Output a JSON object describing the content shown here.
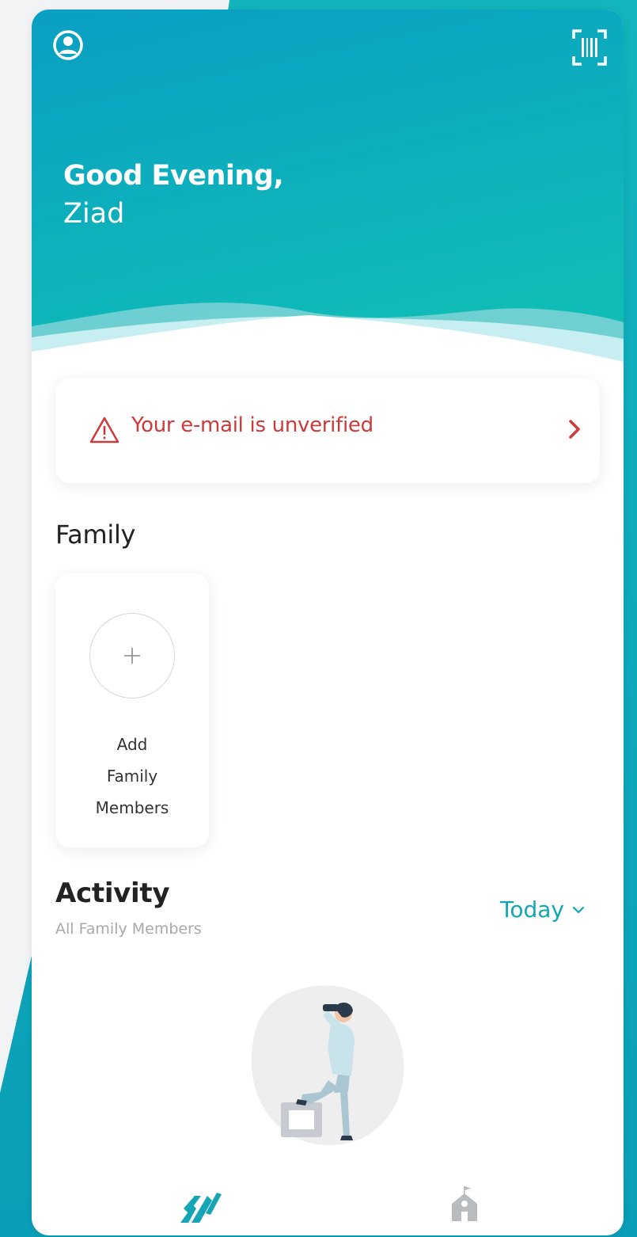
{
  "colors": {
    "header_top": "#0a9fc4",
    "header_bottom": "#10b9b8",
    "alert_red": "#cc3a3a",
    "accent_teal": "#14a7b3",
    "tab_active": "#16a5b5",
    "tab_inactive": "#b9bcbf"
  },
  "header": {
    "greeting": "Good Evening,",
    "user_name": "Ziad",
    "left_icon": "user-circle-icon",
    "right_icon": "barcode-scan-icon"
  },
  "alert": {
    "icon": "warning-triangle-icon",
    "text": "Your e-mail is unverified",
    "action_icon": "chevron-right-icon"
  },
  "family": {
    "title": "Family",
    "add_card": {
      "icon": "plus-icon",
      "label": "Add\nFamily\nMembers"
    }
  },
  "activity": {
    "title": "Activity",
    "subtitle": "All Family Members",
    "filter": {
      "selected": "Today",
      "icon": "chevron-down-icon"
    },
    "empty_state_icon": "explorer-illustration"
  },
  "tabbar": {
    "items": [
      {
        "icon": "app-logo-icon",
        "active": true
      },
      {
        "icon": "school-icon",
        "active": false
      }
    ]
  }
}
